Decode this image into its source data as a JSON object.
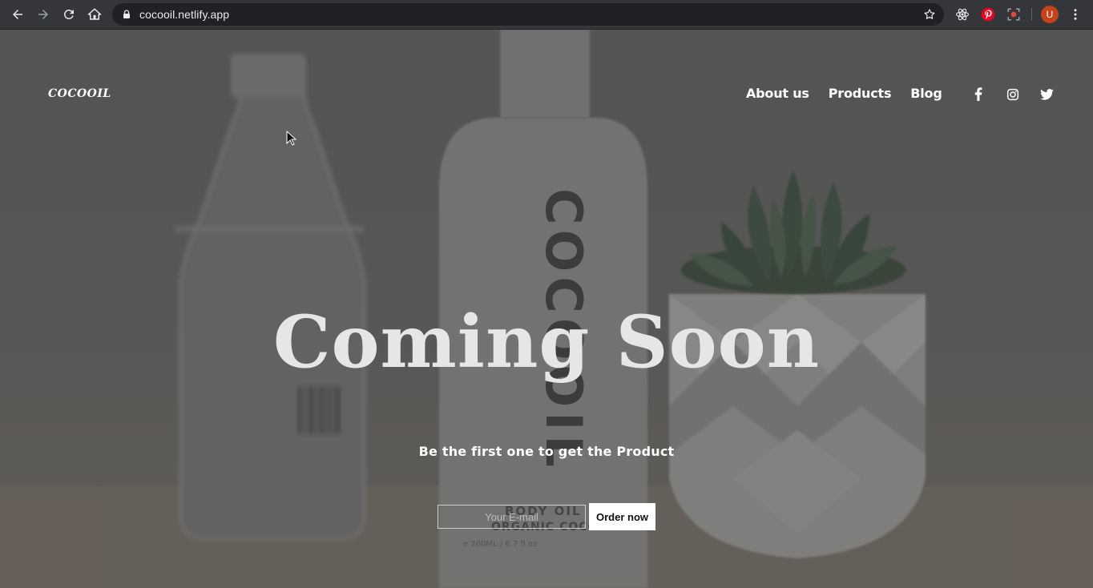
{
  "browser": {
    "url": "cocooil.netlify.app",
    "avatar_letter": "U",
    "icons": [
      "back-icon",
      "forward-icon",
      "reload-icon",
      "home-icon",
      "lock-icon",
      "star-icon",
      "react-devtools-icon",
      "pinterest-icon",
      "screen-capture-icon",
      "menu-kebab-icon"
    ]
  },
  "site": {
    "logo": "COCOOIL",
    "nav": [
      {
        "label": "About us"
      },
      {
        "label": "Products"
      },
      {
        "label": "Blog"
      }
    ],
    "social": [
      "facebook-icon",
      "instagram-icon",
      "twitter-icon"
    ]
  },
  "hero": {
    "headline": "Coming Soon",
    "subheadline": "Be the first one to get the Product",
    "email_placeholder": "Your E-mail",
    "order_button": "Order now",
    "background_lettering": [
      "COCOOIL",
      "BODY OIL",
      "ORGANIC COCONUT"
    ]
  },
  "colors": {
    "chrome_bg": "#35363a",
    "omnibox_bg": "#202124",
    "avatar": "#c5421a",
    "pinterest": "#e60023",
    "headline": "#e6e6e6"
  }
}
